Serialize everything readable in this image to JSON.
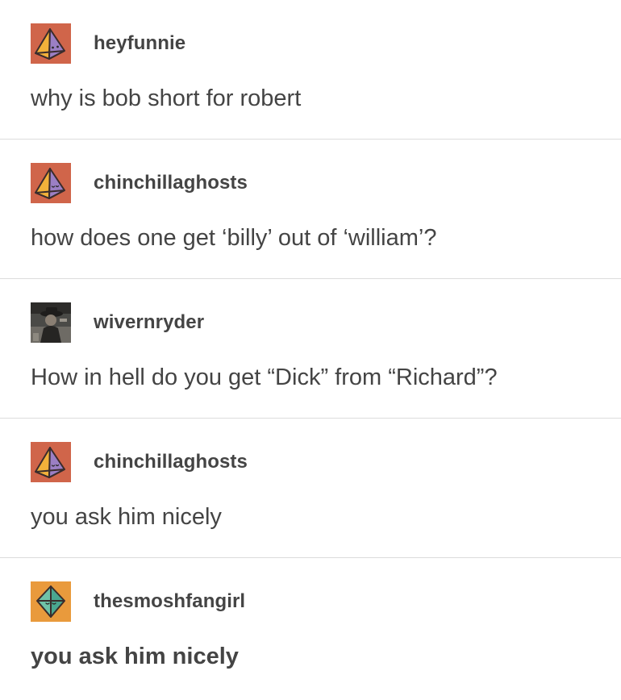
{
  "posts": [
    {
      "username": "heyfunnie",
      "text": "why is bob short for robert",
      "avatar": {
        "icon": "pyramid-avatar-icon",
        "bg": "#d0654a",
        "face": "dots"
      },
      "bold": false
    },
    {
      "username": "chinchillaghosts",
      "text": "how does one get ‘billy’ out of ‘william’?",
      "avatar": {
        "icon": "pyramid-avatar-icon",
        "bg": "#d0654a",
        "face": "smile"
      },
      "bold": false
    },
    {
      "username": "wivernryder",
      "text": "How in hell do you get “Dick” from “Richard”?",
      "avatar": {
        "icon": "photo-avatar-icon",
        "bg": "#4a4a47"
      },
      "bold": false
    },
    {
      "username": "chinchillaghosts",
      "text": "you ask him nicely",
      "avatar": {
        "icon": "pyramid-avatar-icon",
        "bg": "#d0654a",
        "face": "smile"
      },
      "bold": false
    },
    {
      "username": "thesmoshfangirl",
      "text": "you ask him nicely",
      "avatar": {
        "icon": "gem-avatar-icon",
        "bg": "#e99a3c",
        "face": "sleepy"
      },
      "bold": true
    }
  ]
}
